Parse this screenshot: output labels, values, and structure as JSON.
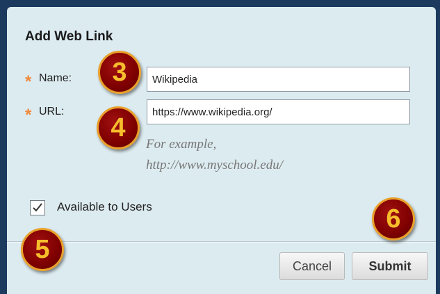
{
  "dialog": {
    "title": "Add Web Link",
    "name_label": "Name:",
    "url_label": "URL:",
    "name_value": "Wikipedia",
    "url_value": "https://www.wikipedia.org/",
    "example_line1": "For example,",
    "example_line2": "http://www.myschool.edu/",
    "available_label": "Available to Users",
    "available_checked": true,
    "cancel_label": "Cancel",
    "submit_label": "Submit",
    "required_marker": "*"
  },
  "callouts": [
    "3",
    "4",
    "5",
    "6"
  ],
  "colors": {
    "frame": "#1b3a5e",
    "panel": "#dcebf0",
    "required": "#f08a3c",
    "callout_fill": "#7e0000",
    "callout_text": "#f6bd2c"
  }
}
